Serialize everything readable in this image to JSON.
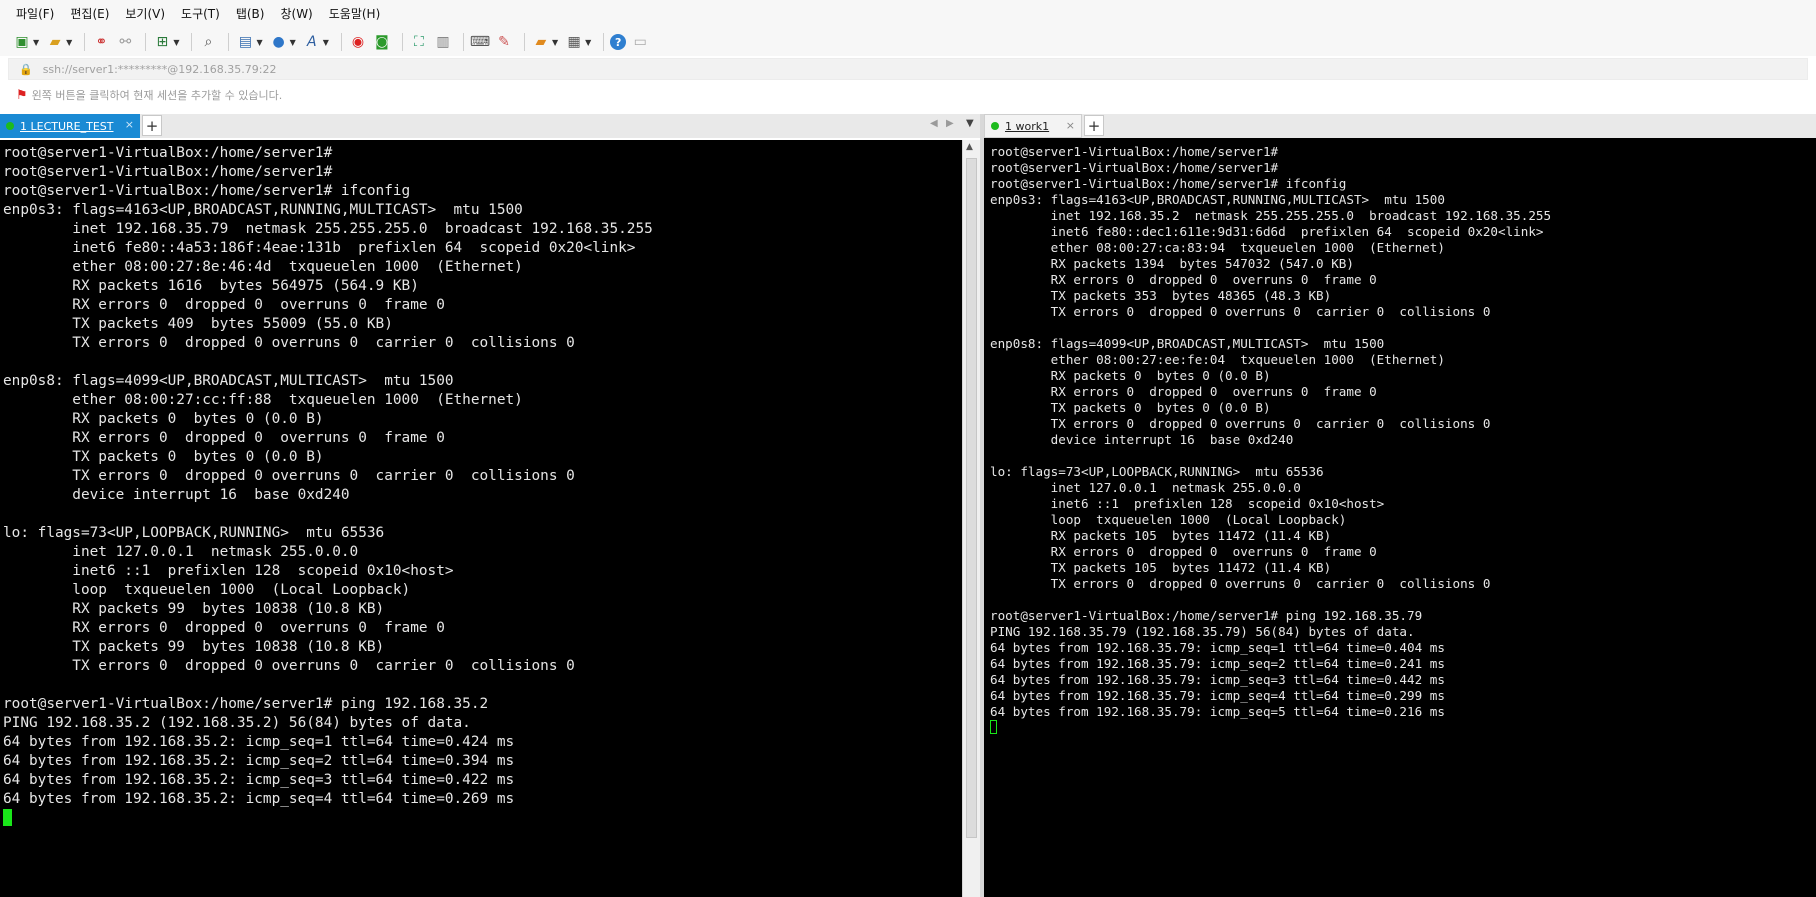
{
  "menu": [
    "파일(F)",
    "편집(E)",
    "보기(V)",
    "도구(T)",
    "탭(B)",
    "창(W)",
    "도움말(H)"
  ],
  "toolbar_icons": [
    "new-session-icon",
    "open-folder-icon",
    "connect-icon",
    "disconnect-icon",
    "new-tab-icon",
    "find-icon",
    "properties-icon",
    "globe-icon",
    "font-icon",
    "xftp-icon",
    "xmanager-icon",
    "fullscreen-icon",
    "lock-icon",
    "keyboard-icon",
    "compose-icon",
    "add-folder-icon",
    "layout-icon",
    "help-icon",
    "chat-icon"
  ],
  "address": {
    "text": "ssh://server1:*********@192.168.35.79:22"
  },
  "info": {
    "text": "왼쪽 버튼을 클릭하여 현재 세션을 추가할 수 있습니다."
  },
  "tabs_left": [
    {
      "label": "1 LECTURE_TEST",
      "close": "×"
    }
  ],
  "tabs_right": [
    {
      "label": "1 work1",
      "close": "×"
    }
  ],
  "tab_add": "+",
  "terminal_left": {
    "lines": [
      "root@server1-VirtualBox:/home/server1#",
      "root@server1-VirtualBox:/home/server1#",
      "root@server1-VirtualBox:/home/server1# ifconfig",
      "enp0s3: flags=4163<UP,BROADCAST,RUNNING,MULTICAST>  mtu 1500",
      "        inet 192.168.35.79  netmask 255.255.255.0  broadcast 192.168.35.255",
      "        inet6 fe80::4a53:186f:4eae:131b  prefixlen 64  scopeid 0x20<link>",
      "        ether 08:00:27:8e:46:4d  txqueuelen 1000  (Ethernet)",
      "        RX packets 1616  bytes 564975 (564.9 KB)",
      "        RX errors 0  dropped 0  overruns 0  frame 0",
      "        TX packets 409  bytes 55009 (55.0 KB)",
      "        TX errors 0  dropped 0 overruns 0  carrier 0  collisions 0",
      "",
      "enp0s8: flags=4099<UP,BROADCAST,MULTICAST>  mtu 1500",
      "        ether 08:00:27:cc:ff:88  txqueuelen 1000  (Ethernet)",
      "        RX packets 0  bytes 0 (0.0 B)",
      "        RX errors 0  dropped 0  overruns 0  frame 0",
      "        TX packets 0  bytes 0 (0.0 B)",
      "        TX errors 0  dropped 0 overruns 0  carrier 0  collisions 0",
      "        device interrupt 16  base 0xd240",
      "",
      "lo: flags=73<UP,LOOPBACK,RUNNING>  mtu 65536",
      "        inet 127.0.0.1  netmask 255.0.0.0",
      "        inet6 ::1  prefixlen 128  scopeid 0x10<host>",
      "        loop  txqueuelen 1000  (Local Loopback)",
      "        RX packets 99  bytes 10838 (10.8 KB)",
      "        RX errors 0  dropped 0  overruns 0  frame 0",
      "        TX packets 99  bytes 10838 (10.8 KB)",
      "        TX errors 0  dropped 0 overruns 0  carrier 0  collisions 0",
      "",
      "root@server1-VirtualBox:/home/server1# ping 192.168.35.2",
      "PING 192.168.35.2 (192.168.35.2) 56(84) bytes of data.",
      "64 bytes from 192.168.35.2: icmp_seq=1 ttl=64 time=0.424 ms",
      "64 bytes from 192.168.35.2: icmp_seq=2 ttl=64 time=0.394 ms",
      "64 bytes from 192.168.35.2: icmp_seq=3 ttl=64 time=0.422 ms",
      "64 bytes from 192.168.35.2: icmp_seq=4 ttl=64 time=0.269 ms"
    ]
  },
  "terminal_right": {
    "lines": [
      "root@server1-VirtualBox:/home/server1#",
      "root@server1-VirtualBox:/home/server1#",
      "root@server1-VirtualBox:/home/server1# ifconfig",
      "enp0s3: flags=4163<UP,BROADCAST,RUNNING,MULTICAST>  mtu 1500",
      "        inet 192.168.35.2  netmask 255.255.255.0  broadcast 192.168.35.255",
      "        inet6 fe80::dec1:611e:9d31:6d6d  prefixlen 64  scopeid 0x20<link>",
      "        ether 08:00:27:ca:83:94  txqueuelen 1000  (Ethernet)",
      "        RX packets 1394  bytes 547032 (547.0 KB)",
      "        RX errors 0  dropped 0  overruns 0  frame 0",
      "        TX packets 353  bytes 48365 (48.3 KB)",
      "        TX errors 0  dropped 0 overruns 0  carrier 0  collisions 0",
      "",
      "enp0s8: flags=4099<UP,BROADCAST,MULTICAST>  mtu 1500",
      "        ether 08:00:27:ee:fe:04  txqueuelen 1000  (Ethernet)",
      "        RX packets 0  bytes 0 (0.0 B)",
      "        RX errors 0  dropped 0  overruns 0  frame 0",
      "        TX packets 0  bytes 0 (0.0 B)",
      "        TX errors 0  dropped 0 overruns 0  carrier 0  collisions 0",
      "        device interrupt 16  base 0xd240",
      "",
      "lo: flags=73<UP,LOOPBACK,RUNNING>  mtu 65536",
      "        inet 127.0.0.1  netmask 255.0.0.0",
      "        inet6 ::1  prefixlen 128  scopeid 0x10<host>",
      "        loop  txqueuelen 1000  (Local Loopback)",
      "        RX packets 105  bytes 11472 (11.4 KB)",
      "        RX errors 0  dropped 0  overruns 0  frame 0",
      "        TX packets 105  bytes 11472 (11.4 KB)",
      "        TX errors 0  dropped 0 overruns 0  carrier 0  collisions 0",
      "",
      "root@server1-VirtualBox:/home/server1# ping 192.168.35.79",
      "PING 192.168.35.79 (192.168.35.79) 56(84) bytes of data.",
      "64 bytes from 192.168.35.79: icmp_seq=1 ttl=64 time=0.404 ms",
      "64 bytes from 192.168.35.79: icmp_seq=2 ttl=64 time=0.241 ms",
      "64 bytes from 192.168.35.79: icmp_seq=3 ttl=64 time=0.442 ms",
      "64 bytes from 192.168.35.79: icmp_seq=4 ttl=64 time=0.299 ms",
      "64 bytes from 192.168.35.79: icmp_seq=5 ttl=64 time=0.216 ms"
    ]
  },
  "colors": {
    "active_tab": "#1a8ad4",
    "terminal_bg": "#000000",
    "terminal_fg": "#e6e6e6",
    "cursor": "#19e619"
  }
}
